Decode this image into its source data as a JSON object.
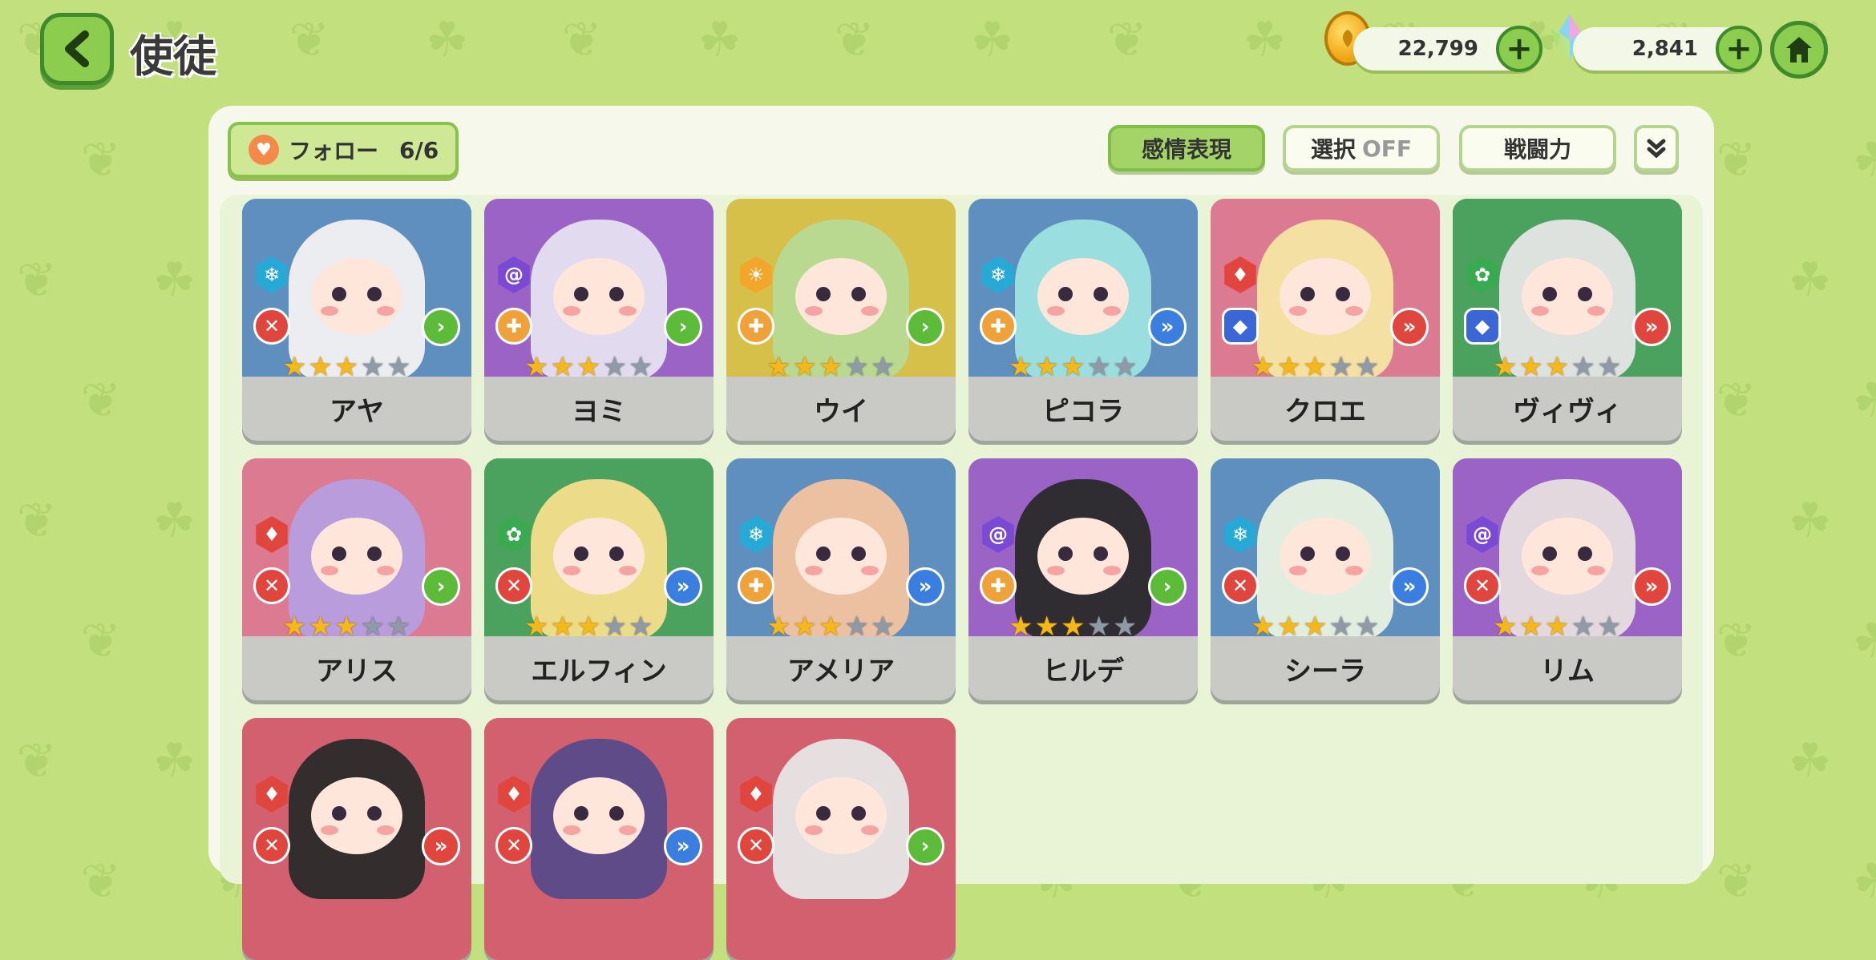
{
  "header": {
    "title": "使徒",
    "gold": "22,799",
    "gems": "2,841",
    "plus_symbol": "+"
  },
  "toolbar": {
    "follow_label": "フォロー",
    "follow_count": "6/6",
    "emotion_label": "感情表現",
    "select_label": "選択",
    "select_state": "OFF",
    "power_label": "戦闘力"
  },
  "colors": {
    "background": "#c2e07e",
    "panel": "#f7f8ec",
    "button_green": "#8ccc4e",
    "card_blue": "#5f8fbf",
    "card_purple": "#9c63c6",
    "card_yellow": "#d6c04a",
    "card_pink": "#dc7a92",
    "card_green": "#4aa25e",
    "card_red": "#d3606e"
  },
  "characters": [
    {
      "name": "アヤ",
      "card_color": "#5f8fbf",
      "hair": "#f2f2f2",
      "element": "snowflake-icon",
      "element_color": "#27a9d6",
      "element_glyph": "❄",
      "role": "swords-icon",
      "role_color": "#e0463e",
      "role_glyph": "✕",
      "go_color": "#5dbb3a",
      "go_glyph": "›",
      "stars": 3
    },
    {
      "name": "ヨミ",
      "card_color": "#9c63c6",
      "hair": "#e6e2f2",
      "element": "spiral-icon",
      "element_color": "#7a4ad4",
      "element_glyph": "@",
      "role": "cross-icon",
      "role_color": "#f0a23a",
      "role_glyph": "✚",
      "go_color": "#5dbb3a",
      "go_glyph": "›",
      "stars": 3
    },
    {
      "name": "ウイ",
      "card_color": "#d6c04a",
      "hair": "#b7d994",
      "element": "sun-icon",
      "element_color": "#f2a62a",
      "element_glyph": "☀",
      "role": "cross-icon",
      "role_color": "#f0a23a",
      "role_glyph": "✚",
      "go_color": "#5dbb3a",
      "go_glyph": "›",
      "stars": 3
    },
    {
      "name": "ピコラ",
      "card_color": "#5f8fbf",
      "hair": "#9ee3e0",
      "element": "snowflake-icon",
      "element_color": "#27a9d6",
      "element_glyph": "❄",
      "role": "cross-icon",
      "role_color": "#f0a23a",
      "role_glyph": "✚",
      "go_color": "#3a7ee0",
      "go_glyph": "»",
      "stars": 3
    },
    {
      "name": "クロエ",
      "card_color": "#dc7a92",
      "hair": "#f4e6a4",
      "element": "fire-icon",
      "element_color": "#e0463e",
      "element_glyph": "♦",
      "role": "shield-icon",
      "role_color": "#3a66d6",
      "role_glyph": "◆",
      "go_color": "#e0463e",
      "go_glyph": "»",
      "stars": 3
    },
    {
      "name": "ヴィヴィ",
      "card_color": "#4aa25e",
      "hair": "#e6e6e6",
      "element": "flower-icon",
      "element_color": "#3aaa52",
      "element_glyph": "✿",
      "role": "shield-icon",
      "role_color": "#3a66d6",
      "role_glyph": "◆",
      "go_color": "#e0463e",
      "go_glyph": "»",
      "stars": 3
    },
    {
      "name": "アリス",
      "card_color": "#dc7a92",
      "hair": "#b69ee0",
      "element": "fire-icon",
      "element_color": "#e0463e",
      "element_glyph": "♦",
      "role": "swords-icon",
      "role_color": "#e0463e",
      "role_glyph": "✕",
      "go_color": "#5dbb3a",
      "go_glyph": "›",
      "stars": 3
    },
    {
      "name": "エルフィン",
      "card_color": "#4aa25e",
      "hair": "#f4de8a",
      "element": "flower-icon",
      "element_color": "#3aaa52",
      "element_glyph": "✿",
      "role": "swords-icon",
      "role_color": "#e0463e",
      "role_glyph": "✕",
      "go_color": "#3a7ee0",
      "go_glyph": "»",
      "stars": 3
    },
    {
      "name": "アメリア",
      "card_color": "#5f8fbf",
      "hair": "#f2c4a0",
      "element": "snowflake-icon",
      "element_color": "#27a9d6",
      "element_glyph": "❄",
      "role": "cross-icon",
      "role_color": "#f0a23a",
      "role_glyph": "✚",
      "go_color": "#3a7ee0",
      "go_glyph": "»",
      "stars": 3
    },
    {
      "name": "ヒルデ",
      "card_color": "#9c63c6",
      "hair": "#2a2a2a",
      "element": "spiral-icon",
      "element_color": "#7a4ad4",
      "element_glyph": "@",
      "role": "cross-icon",
      "role_color": "#f0a23a",
      "role_glyph": "✚",
      "go_color": "#5dbb3a",
      "go_glyph": "›",
      "stars": 3
    },
    {
      "name": "シーラ",
      "card_color": "#5f8fbf",
      "hair": "#e8f2e0",
      "element": "snowflake-icon",
      "element_color": "#27a9d6",
      "element_glyph": "❄",
      "role": "swords-icon",
      "role_color": "#e0463e",
      "role_glyph": "✕",
      "go_color": "#3a7ee0",
      "go_glyph": "»",
      "stars": 3
    },
    {
      "name": "リム",
      "card_color": "#9c63c6",
      "hair": "#e6dede",
      "element": "spiral-icon",
      "element_color": "#7a4ad4",
      "element_glyph": "@",
      "role": "swords-icon",
      "role_color": "#e0463e",
      "role_glyph": "✕",
      "go_color": "#e0463e",
      "go_glyph": "»",
      "stars": 3
    },
    {
      "name": "",
      "card_color": "#d3606e",
      "hair": "#2a2a2a",
      "element": "fire-icon",
      "element_color": "#e0463e",
      "element_glyph": "♦",
      "role": "swords-icon",
      "role_color": "#e0463e",
      "role_glyph": "✕",
      "go_color": "#e0463e",
      "go_glyph": "»",
      "stars": 0
    },
    {
      "name": "",
      "card_color": "#d3606e",
      "hair": "#5a4a8a",
      "element": "fire-icon",
      "element_color": "#e0463e",
      "element_glyph": "♦",
      "role": "swords-icon",
      "role_color": "#e0463e",
      "role_glyph": "✕",
      "go_color": "#3a7ee0",
      "go_glyph": "»",
      "stars": 0
    },
    {
      "name": "",
      "card_color": "#d3606e",
      "hair": "#e6e6e6",
      "element": "fire-icon",
      "element_color": "#e0463e",
      "element_glyph": "♦",
      "role": "swords-icon",
      "role_color": "#e0463e",
      "role_glyph": "✕",
      "go_color": "#5dbb3a",
      "go_glyph": "›",
      "stars": 0
    }
  ]
}
